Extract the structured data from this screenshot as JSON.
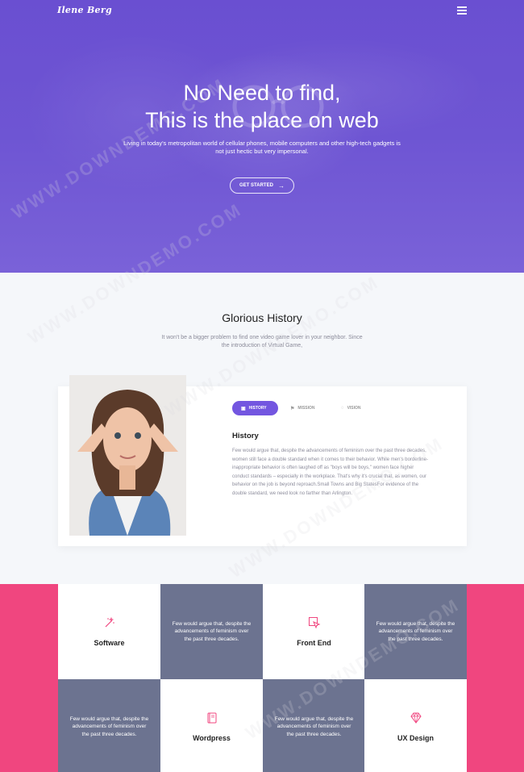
{
  "header": {
    "logo": "Ilene Berg",
    "menu_icon": "hamburger-menu-icon"
  },
  "hero": {
    "title_line1": "No Need to find,",
    "title_line2": "This is the place on web",
    "subtitle": "Living in today's metropolitan world of cellular phones, mobile computers and other high-tech gadgets is not just hectic but very impersonal.",
    "cta_label": "GET STARTED",
    "cta_icon": "arrow-right-icon",
    "arrow_glyph": "→"
  },
  "history": {
    "title": "Glorious History",
    "subtitle": "It won't be a bigger problem to find one video game lover in your neighbor. Since the introduction of Virtual Game,",
    "tabs": [
      {
        "label": "HISTORY",
        "icon": "history-icon",
        "active": true
      },
      {
        "label": "MISSION",
        "icon": "mission-icon",
        "active": false
      },
      {
        "label": "VISION",
        "icon": "vision-icon",
        "active": false
      }
    ],
    "content_heading": "History",
    "content_body": "Few would argue that, despite the advancements of feminism over the past three decades, women still face a double standard when it comes to their behavior. While men's borderline-inappropriate behavior is often laughed off as \"boys will be boys,\" women face higher conduct standards – especially in the workplace. That's why it's crucial that, as women, our behavior on the job is beyond reproach.Small Towns and Big StatesFor evidence of the double standard, we need look no farther than Arlington."
  },
  "services": {
    "tiles": [
      {
        "type": "label",
        "label": "Software",
        "icon": "magic-wand-icon"
      },
      {
        "type": "text",
        "text": "Few would argue that, despite the advancements of feminism over the past three decades."
      },
      {
        "type": "label",
        "label": "Front End",
        "icon": "cursor-pointer-icon"
      },
      {
        "type": "text",
        "text": "Few would argue that, despite the advancements of feminism over the past three decades."
      },
      {
        "type": "text",
        "text": "Few would argue that, despite the advancements of feminism over the past three decades."
      },
      {
        "type": "label",
        "label": "Wordpress",
        "icon": "book-icon"
      },
      {
        "type": "text",
        "text": "Few would argue that, despite the advancements of feminism over the past three decades."
      },
      {
        "type": "label",
        "label": "UX Design",
        "icon": "diamond-icon"
      }
    ]
  },
  "watermark": {
    "text": "WWW.DOWNDEMO.COM"
  },
  "colors": {
    "hero_purple": "#6a4fd1",
    "accent_purple": "#7356e0",
    "pink": "#f0467f",
    "slate": "#6c7390",
    "icon_pink": "#f0467f"
  }
}
